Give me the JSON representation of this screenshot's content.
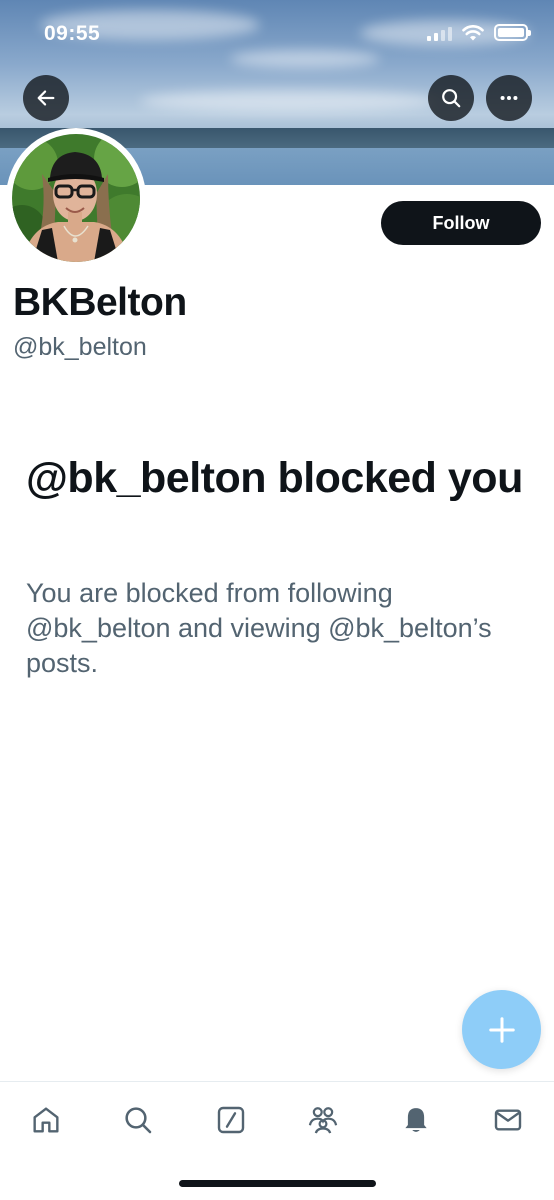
{
  "status_bar": {
    "time": "09:55"
  },
  "header": {
    "back_icon": "arrow-left-icon",
    "search_icon": "search-icon",
    "more_icon": "more-horizontal-icon"
  },
  "profile": {
    "display_name": "BKBelton",
    "handle": "@bk_belton",
    "follow_label": "Follow"
  },
  "blocked": {
    "title": "@bk_belton blocked you",
    "message": "You are blocked from following @bk_belton and viewing @bk_belton’s posts."
  },
  "fab": {
    "icon": "plus-icon"
  },
  "bottom_nav": {
    "items": [
      "home-icon",
      "search-icon",
      "grok-icon",
      "communities-icon",
      "notifications-icon",
      "messages-icon"
    ]
  },
  "colors": {
    "text_primary": "#0f1419",
    "text_secondary": "#536471",
    "follow_bg": "#0f1419",
    "fab_bg": "#8ecdf8",
    "icon_gray": "#536471"
  }
}
